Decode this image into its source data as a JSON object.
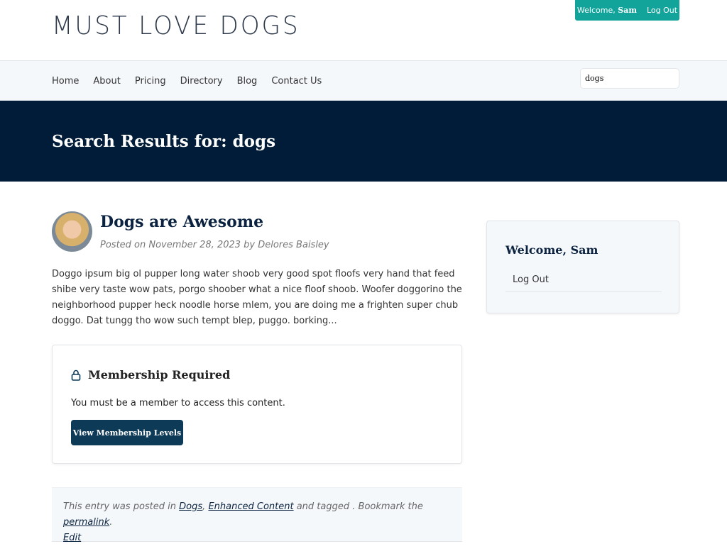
{
  "header": {
    "logo": "MUST LOVE DOGS",
    "welcome_prefix": "Welcome,",
    "welcome_name": "Sam",
    "logout": "Log Out"
  },
  "nav": {
    "items": [
      "Home",
      "About",
      "Pricing",
      "Directory",
      "Blog",
      "Contact Us"
    ],
    "search_value": "dogs"
  },
  "hero": {
    "title": "Search Results for: dogs"
  },
  "post": {
    "title": "Dogs are Awesome",
    "meta": "Posted on November 28, 2023 by Delores Baisley",
    "excerpt": "Doggo ipsum big ol pupper long water shoob very good spot floofs very hand that feed shibe very taste wow pats, porgo shoober what a nice floof shoob. Woofer doggorino the neighborhood pupper heck noodle horse mlem, you are doing me a frighten super chub doggo. Dat tungg tho wow such tempt blep, puggo. borking...",
    "membership": {
      "title": "Membership Required",
      "text": "You must be a member to access this content.",
      "button": "View Membership Levels"
    },
    "footer": {
      "prefix": "This entry was posted in",
      "cat1": "Dogs",
      "sep": ",",
      "cat2": "Enhanced Content",
      "mid": "and tagged . Bookmark the",
      "permalink": "permalink",
      "end": ".",
      "edit": "Edit"
    }
  },
  "sidebar": {
    "title": "Welcome, Sam",
    "logout": "Log Out"
  },
  "colors": {
    "accent": "#12a39a",
    "hero": "#011c38",
    "button": "#0d3a57"
  }
}
